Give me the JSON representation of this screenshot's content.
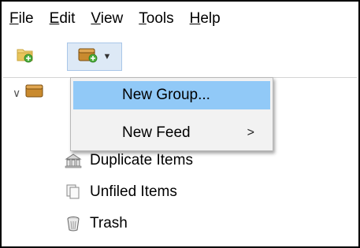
{
  "menubar": {
    "items": [
      {
        "first": "F",
        "rest": "ile"
      },
      {
        "first": "E",
        "rest": "dit"
      },
      {
        "first": "V",
        "rest": "iew"
      },
      {
        "first": "T",
        "rest": "ools"
      },
      {
        "first": "H",
        "rest": "elp"
      }
    ]
  },
  "toolbar": {
    "new_collection_icon": "folder-add-icon",
    "new_library_icon": "library-add-icon",
    "dropdown_icon": "chevron-down-icon"
  },
  "dropdown": {
    "items": [
      {
        "label": "New Group...",
        "highlighted": true
      },
      {
        "label": "New Feed",
        "submenu_arrow": ">"
      }
    ]
  },
  "tree": {
    "items": [
      {
        "label": "Duplicate Items",
        "icon": "duplicate-icon"
      },
      {
        "label": "Unfiled Items",
        "icon": "unfiled-icon"
      },
      {
        "label": "Trash",
        "icon": "trash-icon"
      }
    ]
  },
  "colors": {
    "highlight": "#91c9f7",
    "menu_bg": "#f2f2f2",
    "toolbar_btn_active": "#dde9f6",
    "folder_yellow": "#e8c45a",
    "library_brown": "#c98a2e",
    "add_green": "#4caf3c"
  }
}
